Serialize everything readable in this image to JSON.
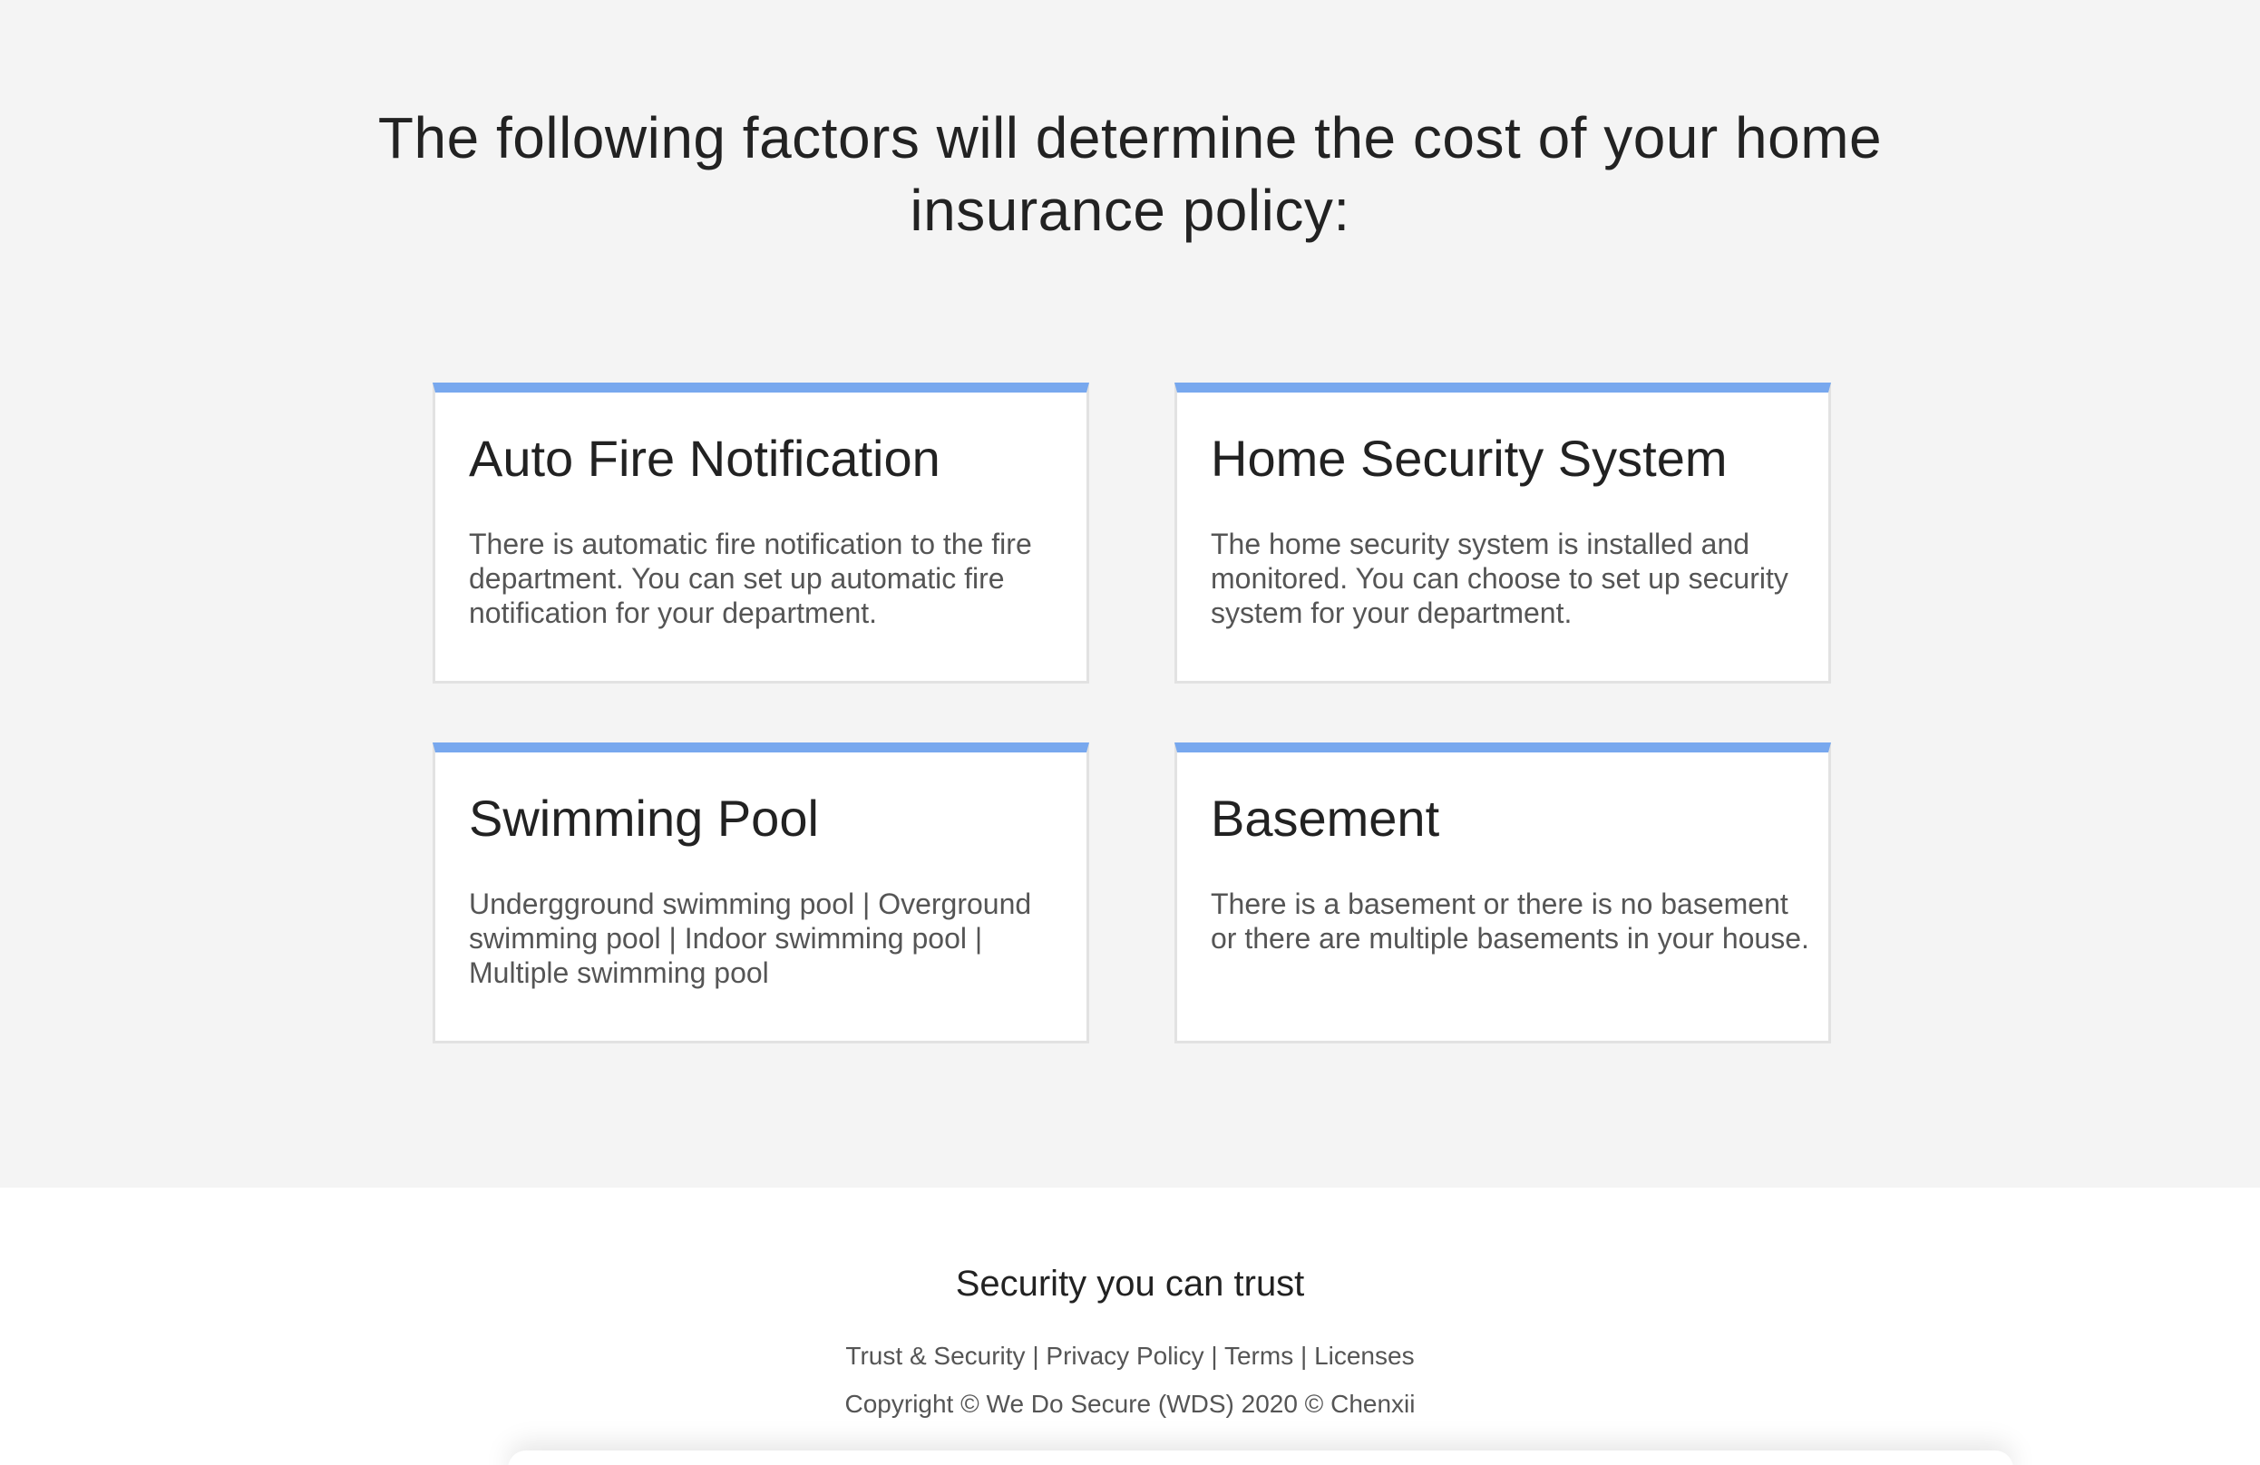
{
  "heading": "The following factors will determine the cost of your home insurance policy:",
  "colors": {
    "section_background": "#f4f4f4",
    "card_accent": "#78a8ee",
    "card_border": "#e2e2e2",
    "heading_text": "#222222",
    "body_text": "#555555"
  },
  "cards": [
    {
      "title": "Auto Fire Notification",
      "text": "There is automatic fire notification to the fire department. You can set up automatic fire notification for your department."
    },
    {
      "title": "Home Security System",
      "text": "The home security system is installed and monitored. You can choose to set up security system for your department."
    },
    {
      "title": "Swimming Pool",
      "text": "Undergground swimming pool | Overground swimming pool | Indoor swimming pool | Multiple swimming pool"
    },
    {
      "title": "Basement",
      "text": "There is a basement or there is no basement or there are multiple basements in your house."
    }
  ],
  "footer": {
    "title": "Security you can trust",
    "links": [
      {
        "label": "Trust & Security"
      },
      {
        "label": "Privacy Policy"
      },
      {
        "label": "Terms"
      },
      {
        "label": "Licenses"
      }
    ],
    "separator": " | ",
    "copyright": "Copyright © We Do Secure (WDS) 2020 © Chenxii"
  }
}
